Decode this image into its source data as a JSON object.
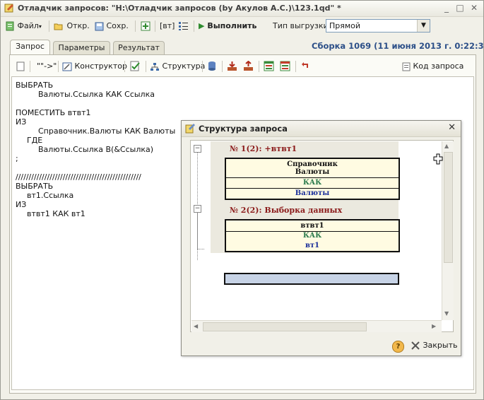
{
  "window": {
    "title": "Отладчик запросов: \"H:\\Отладчик запросов (by Акулов А.С.)\\123.1qd\" *",
    "controls": [
      "_",
      "□",
      "✕"
    ]
  },
  "toolbar": {
    "file_label": "Файл",
    "open_label": "Откр.",
    "save_label": "Сохр.",
    "bt_label": "[вт]",
    "run_label": "Выполнить",
    "export_type_label": "Тип выгрузки:",
    "export_type_value": "Прямой"
  },
  "tabs": [
    "Запрос",
    "Параметры",
    "Результат"
  ],
  "build_info": "Сборка 1069 (11 июня 2013 г. 0:22:30)",
  "editor_toolbar": {
    "quote_label": "\"\"->\"",
    "constructor_label": "Конструктор",
    "structure_label": "Структура",
    "query_code_label": "Код запроса"
  },
  "code_lines": [
    "ВЫБРАТЬ",
    "\tВалюты.Ссылка КАК Ссылка",
    "",
    "ПОМЕСТИТЬ втвт1",
    "ИЗ",
    "\tСправочник.Валюты КАК Валюты",
    "ГДЕ",
    "\tВалюты.Ссылка В(&Ссылка)",
    ";",
    "",
    "////////////////////////////////////////////////",
    "ВЫБРАТЬ",
    "\tвт1.Ссылка",
    "ИЗ",
    "\tвтвт1 КАК вт1"
  ],
  "dialog": {
    "title": "Структура запроса",
    "close_symbol": "✕",
    "groups": [
      {
        "header": "№ 1(2): +втвт1",
        "source": "Справочник\nВалюты",
        "kak": "КАК",
        "alias": "Валюты"
      },
      {
        "header": "№ 2(2): Выборка данных",
        "source": "втвт1",
        "kak": "КАК",
        "alias": "вт1"
      }
    ],
    "tree_expanders": [
      "−",
      "−"
    ],
    "help_symbol": "?",
    "close_label": "Закрыть"
  },
  "colors": {
    "header_text": "#8b1a1a",
    "kak_text": "#2e7d4f",
    "alias_text": "#1b2f9a",
    "build_text": "#2c4f88",
    "box_fill": "#fffbe2"
  }
}
